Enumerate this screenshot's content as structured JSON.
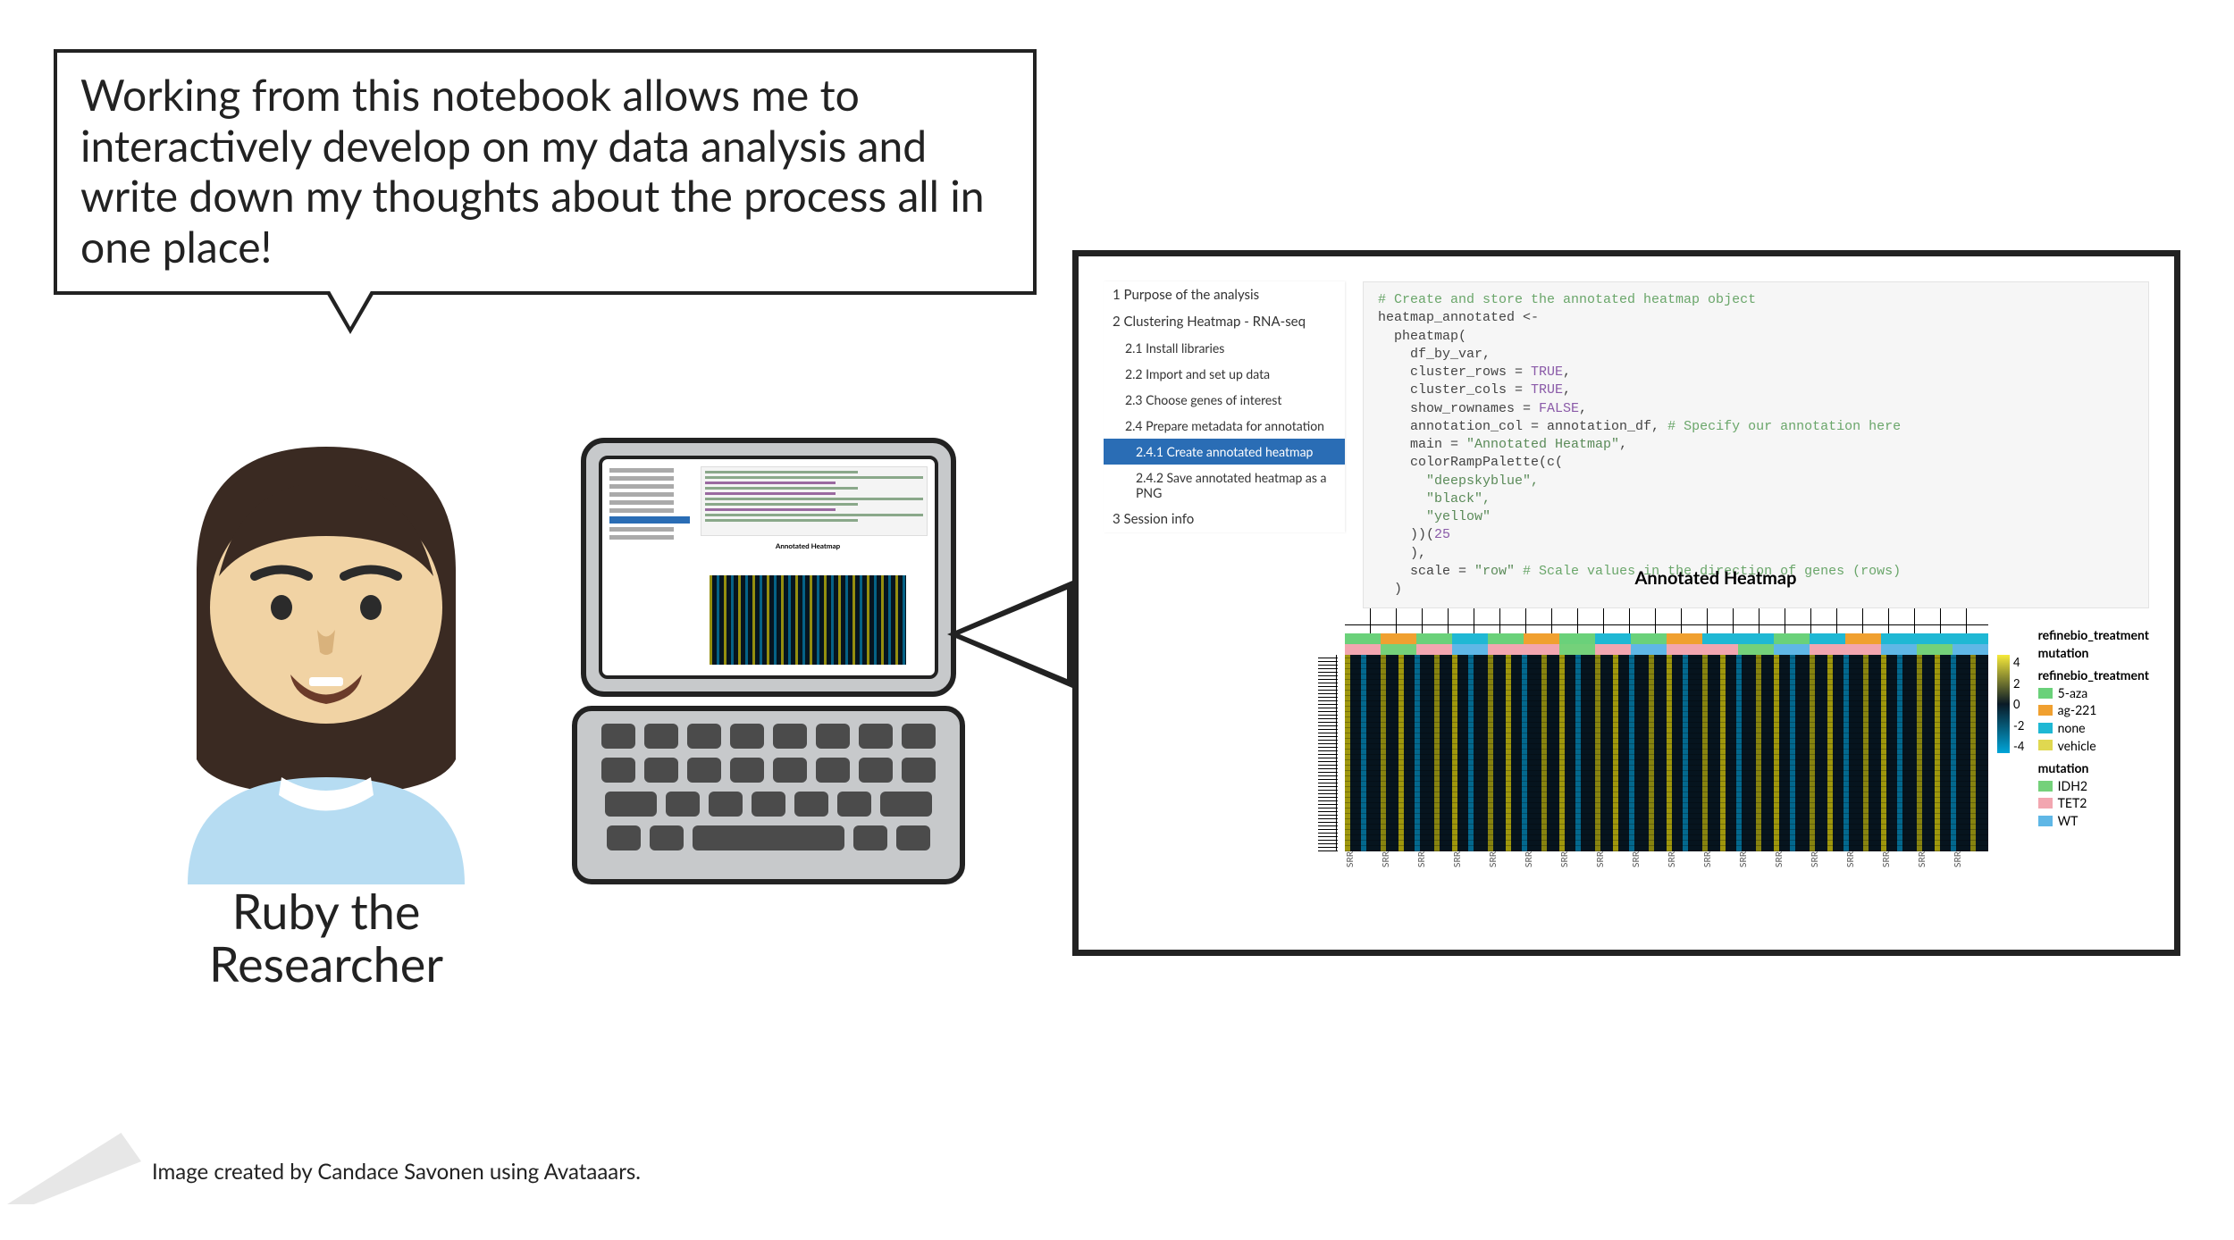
{
  "speech_text": "Working from this notebook allows me to interactively develop on my data analysis and write down my thoughts about the process all in one place!",
  "avatar_caption_line1": "Ruby the",
  "avatar_caption_line2": "Researcher",
  "credit": "Image created by Candace Savonen using Avataaars.",
  "toc": {
    "s1": "1 Purpose of the analysis",
    "s2": "2 Clustering Heatmap - RNA-seq",
    "s2_1": "2.1 Install libraries",
    "s2_2": "2.2 Import and set up data",
    "s2_3": "2.3 Choose genes of interest",
    "s2_4": "2.4 Prepare metadata for annotation",
    "s2_4_1": "2.4.1 Create annotated heatmap",
    "s2_4_2": "2.4.2 Save annotated heatmap as a PNG",
    "s3": "3 Session info"
  },
  "code": {
    "l1": "# Create and store the annotated heatmap object",
    "l2": "heatmap_annotated <-",
    "l3": "  pheatmap(",
    "l4": "    df_by_var,",
    "l5a": "    cluster_rows = ",
    "l5b": "TRUE",
    "l5c": ",",
    "l6a": "    cluster_cols = ",
    "l6b": "TRUE",
    "l6c": ",",
    "l7a": "    show_rownames = ",
    "l7b": "FALSE",
    "l7c": ",",
    "l8a": "    annotation_col = annotation_df, ",
    "l8b": "# Specify our annotation here",
    "l9a": "    main = ",
    "l9b": "\"Annotated Heatmap\"",
    "l9c": ",",
    "l10": "    colorRampPalette(c(",
    "l11": "      \"deepskyblue\",",
    "l12": "      \"black\",",
    "l13": "      \"yellow\"",
    "l14a": "    ))(",
    "l14b": "25",
    "l15": "    ),",
    "l16a": "    scale = ",
    "l16b": "\"row\"",
    "l16c": " # Scale values in the direction of genes (rows)",
    "l17": "  )"
  },
  "plot_title": "Annotated Heatmap",
  "legend": {
    "treat_hdr": "refinebio_treatment",
    "mut_row_hdr": "mutation",
    "treat1": "5-aza",
    "treat2": "ag-221",
    "treat3": "none",
    "treat4": "vehicle",
    "mut_hdr": "mutation",
    "mut1": "IDH2",
    "mut2": "TET2",
    "mut3": "WT"
  },
  "scale": {
    "hi": "4",
    "h2": "2",
    "mid": "0",
    "l2": "-2",
    "lo": "-4"
  },
  "xtick": "SRR",
  "colors": {
    "treat1": "#6ad17a",
    "treat2": "#f0a030",
    "treat3": "#1fb8d4",
    "treat4": "#e0d850",
    "mut1": "#74d17a",
    "mut2": "#f2a6b0",
    "mut3": "#5fb7e6"
  }
}
